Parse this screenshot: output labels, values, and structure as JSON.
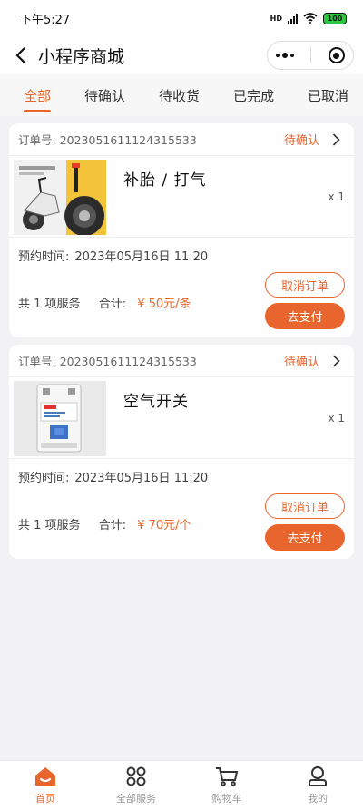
{
  "status_bar": {
    "time": "下午5:27",
    "network": "HD",
    "battery": "100"
  },
  "nav": {
    "title": "小程序商城"
  },
  "tabs": [
    "全部",
    "待确认",
    "待收货",
    "已完成",
    "已取消"
  ],
  "active_tab": "全部",
  "orders": [
    {
      "order_label": "订单号:",
      "order_no": "2023051611124315533",
      "status": "待确认",
      "image": "scooter-tire-repair-photo",
      "item_name": "补胎 / 打气",
      "qty": "x 1",
      "booking_label": "预约时间:",
      "booking_time": "2023年05月16日 11:20",
      "count_text": "共 1 项服务",
      "total_label": "合计:",
      "price": "¥ 50元/条",
      "cancel_label": "取消订单",
      "pay_label": "去支付"
    },
    {
      "order_label": "订单号:",
      "order_no": "2023051611124315533",
      "status": "待确认",
      "image": "circuit-breaker-photo",
      "item_name": "空气开关",
      "qty": "x 1",
      "booking_label": "预约时间:",
      "booking_time": "2023年05月16日 11:20",
      "count_text": "共 1 项服务",
      "total_label": "合计:",
      "price": "¥ 70元/个",
      "cancel_label": "取消订单",
      "pay_label": "去支付"
    }
  ],
  "tabbar": [
    {
      "label": "首页",
      "icon": "home-icon",
      "active": true
    },
    {
      "label": "全部服务",
      "icon": "grid-icon",
      "active": false
    },
    {
      "label": "购物车",
      "icon": "cart-icon",
      "active": false
    },
    {
      "label": "我的",
      "icon": "user-icon",
      "active": false
    }
  ],
  "colors": {
    "accent": "#e8662d",
    "background": "#f2f2f4"
  }
}
